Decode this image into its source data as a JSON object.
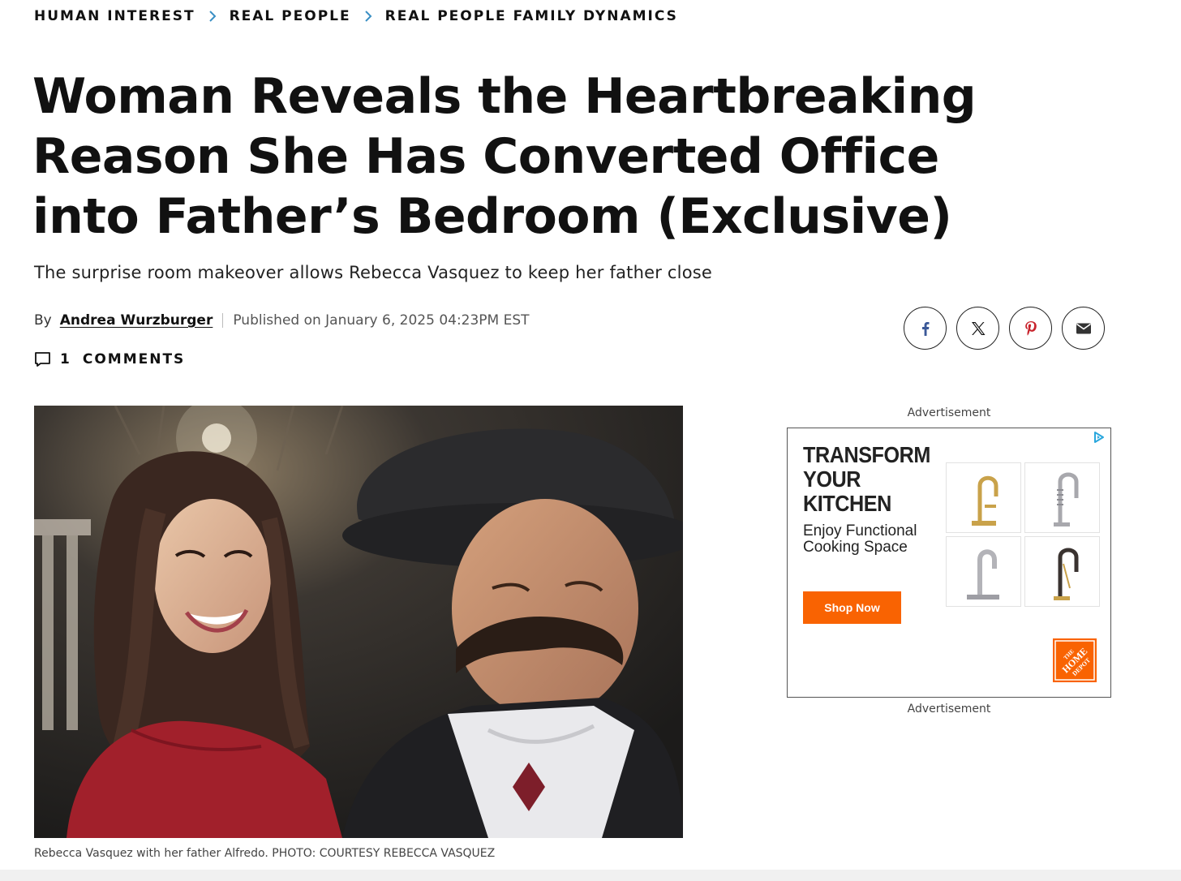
{
  "breadcrumb": {
    "items": [
      "HUMAN INTEREST",
      "REAL PEOPLE",
      "REAL PEOPLE FAMILY DYNAMICS"
    ],
    "separator_color": "#3a8fc4"
  },
  "article": {
    "headline": "Woman Reveals the Heartbreaking Reason She Has Converted Office into Father’s Bedroom (Exclusive)",
    "dek": "The surprise room makeover allows Rebecca Vasquez to keep her father close",
    "by_label": "By",
    "author": "Andrea Wurzburger",
    "published": "Published on January 6, 2025 04:23PM EST",
    "comments_count": "1",
    "comments_label": "COMMENTS",
    "photo_caption": "Rebecca Vasquez with her father Alfredo. PHOTO: COURTESY REBECCA VASQUEZ"
  },
  "share": {
    "buttons": [
      "facebook-icon",
      "x-icon",
      "pinterest-icon",
      "email-icon"
    ]
  },
  "ad": {
    "label_top": "Advertisement",
    "label_bottom": "Advertisement",
    "title": "TRANSFORM YOUR KITCHEN",
    "body": "Enjoy Functional Cooking Space",
    "cta": "Shop Now",
    "brand": "THE HOME DEPOT",
    "cta_color": "#f96302"
  }
}
